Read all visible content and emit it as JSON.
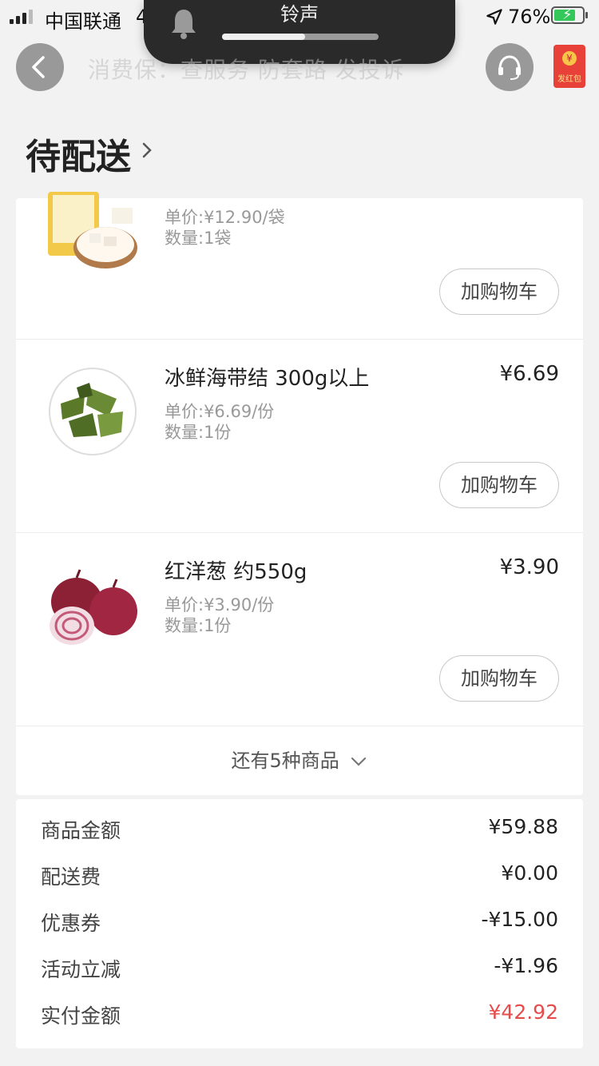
{
  "status_bar": {
    "carrier": "中国联通",
    "network": "4",
    "battery_percent": "76%",
    "battery_level": 0.76
  },
  "ringer_overlay": {
    "label": "铃声",
    "volume_level": 0.53
  },
  "header": {
    "watermark": "消费保：查服务 防套路 发投诉",
    "red_packet_label": "发红包",
    "red_packet_coin": "¥"
  },
  "page_title": "待配送",
  "products": [
    {
      "name": "",
      "price": "",
      "unit_price": "单价:¥12.90/袋",
      "quantity": "数量:1袋",
      "add_to_cart": "加购物车"
    },
    {
      "name": "冰鲜海带结  300g以上",
      "price": "¥6.69",
      "unit_price": "单价:¥6.69/份",
      "quantity": "数量:1份",
      "add_to_cart": "加购物车"
    },
    {
      "name": "红洋葱 约550g",
      "price": "¥3.90",
      "unit_price": "单价:¥3.90/份",
      "quantity": "数量:1份",
      "add_to_cart": "加购物车"
    }
  ],
  "more_items": "还有5种商品",
  "summary": {
    "goods_amount_label": "商品金额",
    "goods_amount": "¥59.88",
    "delivery_fee_label": "配送费",
    "delivery_fee": "¥0.00",
    "coupon_label": "优惠券",
    "coupon": "-¥15.00",
    "discount_label": "活动立减",
    "discount": "-¥1.96",
    "paid_label": "实付金额",
    "paid": "¥42.92"
  },
  "colors": {
    "accent_red": "#e74c4c",
    "background": "#f2f2f2"
  }
}
